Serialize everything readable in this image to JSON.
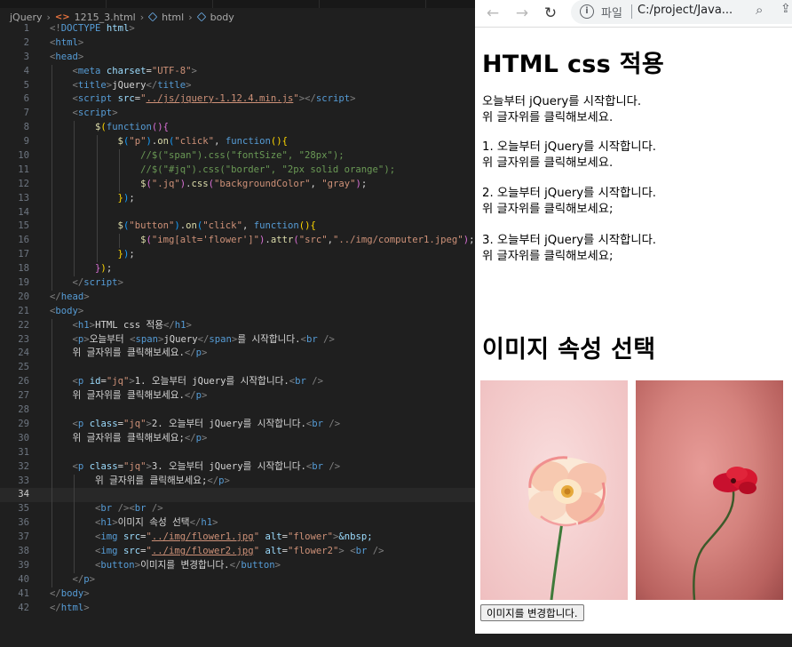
{
  "editor": {
    "breadcrumb": [
      "jQuery",
      "1215_3.html",
      "html",
      "body"
    ],
    "active_line": 34,
    "lines": [
      {
        "n": 1,
        "i": 0,
        "h": "<span class='tg'>&lt;!</span><span class='tn'>DOCTYPE</span> <span class='at'>html</span><span class='tg'>&gt;</span>"
      },
      {
        "n": 2,
        "i": 0,
        "h": "<span class='tg'>&lt;</span><span class='tn'>html</span><span class='tg'>&gt;</span>"
      },
      {
        "n": 3,
        "i": 0,
        "h": "<span class='tg'>&lt;</span><span class='tn'>head</span><span class='tg'>&gt;</span>"
      },
      {
        "n": 4,
        "i": 1,
        "h": "    <span class='tg'>&lt;</span><span class='tn'>meta</span> <span class='at'>charset</span>=<span class='sv'>\"UTF-8\"</span><span class='tg'>&gt;</span>"
      },
      {
        "n": 5,
        "i": 1,
        "h": "    <span class='tg'>&lt;</span><span class='tn'>title</span><span class='tg'>&gt;</span>jQuery<span class='tg'>&lt;/</span><span class='tn'>title</span><span class='tg'>&gt;</span>"
      },
      {
        "n": 6,
        "i": 1,
        "h": "    <span class='tg'>&lt;</span><span class='tn'>script</span> <span class='at'>src</span>=<span class='sv'>\"<span class='uline'>../js/jquery-1.12.4.min.js</span>\"</span><span class='tg'>&gt;&lt;/</span><span class='tn'>script</span><span class='tg'>&gt;</span>"
      },
      {
        "n": 7,
        "i": 1,
        "h": "    <span class='tg'>&lt;</span><span class='tn'>script</span><span class='tg'>&gt;</span>"
      },
      {
        "n": 8,
        "i": 2,
        "h": "        <span class='fn'>$</span><span class='b1'>(</span><span class='kw'>function</span><span class='b2'>()</span><span class='b2'>{</span>"
      },
      {
        "n": 9,
        "i": 3,
        "h": "            <span class='fn'>$</span><span class='b3'>(</span><span class='sv'>\"p\"</span><span class='b3'>)</span>.<span class='fn'>on</span><span class='b3'>(</span><span class='sv'>\"click\"</span>, <span class='kw'>function</span><span class='b1'>()</span><span class='b1'>{</span>"
      },
      {
        "n": 10,
        "i": 4,
        "h": "                <span class='cm'>//$(\"span\").css(\"fontSize\", \"28px\");</span>"
      },
      {
        "n": 11,
        "i": 4,
        "h": "                <span class='cm'>//$(\"#jq\").css(\"border\", \"2px solid orange\");</span>"
      },
      {
        "n": 12,
        "i": 4,
        "h": "                <span class='fn'>$</span><span class='b2'>(</span><span class='sv'>\".jq\"</span><span class='b2'>)</span>.<span class='fn'>css</span><span class='b2'>(</span><span class='sv'>\"backgroundColor\"</span>, <span class='sv'>\"gray\"</span><span class='b2'>)</span>;"
      },
      {
        "n": 13,
        "i": 3,
        "h": "            <span class='b1'>}</span><span class='b3'>)</span>;"
      },
      {
        "n": 14,
        "i": 3,
        "h": ""
      },
      {
        "n": 15,
        "i": 3,
        "h": "            <span class='fn'>$</span><span class='b3'>(</span><span class='sv'>\"button\"</span><span class='b3'>)</span>.<span class='fn'>on</span><span class='b3'>(</span><span class='sv'>\"click\"</span>, <span class='kw'>function</span><span class='b1'>()</span><span class='b1'>{</span>"
      },
      {
        "n": 16,
        "i": 4,
        "h": "                <span class='fn'>$</span><span class='b2'>(</span><span class='sv'>\"img[alt='flower']\"</span><span class='b2'>)</span>.<span class='fn'>attr</span><span class='b2'>(</span><span class='sv'>\"src\"</span>,<span class='sv'>\"../img/computer1.jpeg\"</span><span class='b2'>)</span>;"
      },
      {
        "n": 17,
        "i": 3,
        "h": "            <span class='b1'>}</span><span class='b3'>)</span>;"
      },
      {
        "n": 18,
        "i": 2,
        "h": "        <span class='b2'>}</span><span class='b1'>)</span>;"
      },
      {
        "n": 19,
        "i": 1,
        "h": "    <span class='tg'>&lt;/</span><span class='tn'>script</span><span class='tg'>&gt;</span>"
      },
      {
        "n": 20,
        "i": 0,
        "h": "<span class='tg'>&lt;/</span><span class='tn'>head</span><span class='tg'>&gt;</span>"
      },
      {
        "n": 21,
        "i": 0,
        "h": "<span class='tg'>&lt;</span><span class='tn'>body</span><span class='tg'>&gt;</span>"
      },
      {
        "n": 22,
        "i": 1,
        "h": "    <span class='tg'>&lt;</span><span class='tn'>h1</span><span class='tg'>&gt;</span>HTML css 적용<span class='tg'>&lt;/</span><span class='tn'>h1</span><span class='tg'>&gt;</span>"
      },
      {
        "n": 23,
        "i": 1,
        "h": "    <span class='tg'>&lt;</span><span class='tn'>p</span><span class='tg'>&gt;</span>오늘부터 <span class='tg'>&lt;</span><span class='tn'>span</span><span class='tg'>&gt;</span>jQuery<span class='tg'>&lt;/</span><span class='tn'>span</span><span class='tg'>&gt;</span>를 시작합니다.<span class='tg'>&lt;</span><span class='tn'>br</span> <span class='tg'>/&gt;</span>"
      },
      {
        "n": 24,
        "i": 1,
        "h": "    위 글자위를 클릭해보세요.<span class='tg'>&lt;/</span><span class='tn'>p</span><span class='tg'>&gt;</span>"
      },
      {
        "n": 25,
        "i": 1,
        "h": ""
      },
      {
        "n": 26,
        "i": 1,
        "h": "    <span class='tg'>&lt;</span><span class='tn'>p</span> <span class='at'>id</span>=<span class='sv'>\"jq\"</span><span class='tg'>&gt;</span>1. 오늘부터 jQuery를 시작합니다.<span class='tg'>&lt;</span><span class='tn'>br</span> <span class='tg'>/&gt;</span>"
      },
      {
        "n": 27,
        "i": 1,
        "h": "    위 글자위를 클릭해보세요.<span class='tg'>&lt;/</span><span class='tn'>p</span><span class='tg'>&gt;</span>"
      },
      {
        "n": 28,
        "i": 1,
        "h": ""
      },
      {
        "n": 29,
        "i": 1,
        "h": "    <span class='tg'>&lt;</span><span class='tn'>p</span> <span class='at'>class</span>=<span class='sv'>\"jq\"</span><span class='tg'>&gt;</span>2. 오늘부터 jQuery를 시작합니다.<span class='tg'>&lt;</span><span class='tn'>br</span> <span class='tg'>/&gt;</span>"
      },
      {
        "n": 30,
        "i": 1,
        "h": "    위 글자위를 클릭해보세요;<span class='tg'>&lt;/</span><span class='tn'>p</span><span class='tg'>&gt;</span>"
      },
      {
        "n": 31,
        "i": 1,
        "h": ""
      },
      {
        "n": 32,
        "i": 1,
        "h": "    <span class='tg'>&lt;</span><span class='tn'>p</span> <span class='at'>class</span>=<span class='sv'>\"jq\"</span><span class='tg'>&gt;</span>3. 오늘부터 jQuery를 시작합니다.<span class='tg'>&lt;</span><span class='tn'>br</span> <span class='tg'>/&gt;</span>"
      },
      {
        "n": 33,
        "i": 2,
        "h": "        위 글자위를 클릭해보세요;<span class='tg'>&lt;/</span><span class='tn'>p</span><span class='tg'>&gt;</span>"
      },
      {
        "n": 34,
        "i": 2,
        "h": ""
      },
      {
        "n": 35,
        "i": 2,
        "h": "        <span class='tg'>&lt;</span><span class='tn'>br</span> <span class='tg'>/&gt;&lt;</span><span class='tn'>br</span> <span class='tg'>/&gt;</span>"
      },
      {
        "n": 36,
        "i": 2,
        "h": "        <span class='tg'>&lt;</span><span class='tn'>h1</span><span class='tg'>&gt;</span>이미지 속성 선택<span class='tg'>&lt;/</span><span class='tn'>h1</span><span class='tg'>&gt;</span>"
      },
      {
        "n": 37,
        "i": 2,
        "h": "        <span class='tg'>&lt;</span><span class='tn'>img</span> <span class='at'>src</span>=<span class='sv'>\"<span class='uline'>../img/flower1.jpg</span>\"</span> <span class='at'>alt</span>=<span class='sv'>\"flower\"</span><span class='tg'>&gt;</span><span class='at'>&amp;nbsp;</span>"
      },
      {
        "n": 38,
        "i": 2,
        "h": "        <span class='tg'>&lt;</span><span class='tn'>img</span> <span class='at'>src</span>=<span class='sv'>\"<span class='uline'>../img/flower2.jpg</span>\"</span> <span class='at'>alt</span>=<span class='sv'>\"flower2\"</span><span class='tg'>&gt;</span> <span class='tg'>&lt;</span><span class='tn'>br</span> <span class='tg'>/&gt;</span>"
      },
      {
        "n": 39,
        "i": 2,
        "h": "        <span class='tg'>&lt;</span><span class='tn'>button</span><span class='tg'>&gt;</span>이미지를 변경합니다.<span class='tg'>&lt;/</span><span class='tn'>button</span><span class='tg'>&gt;</span>"
      },
      {
        "n": 40,
        "i": 1,
        "h": "    <span class='tg'>&lt;/</span><span class='tn'>p</span><span class='tg'>&gt;</span>"
      },
      {
        "n": 41,
        "i": 0,
        "h": "<span class='tg'>&lt;/</span><span class='tn'>body</span><span class='tg'>&gt;</span>"
      },
      {
        "n": 42,
        "i": 0,
        "h": "<span class='tg'>&lt;/</span><span class='tn'>html</span><span class='tg'>&gt;</span>"
      }
    ]
  },
  "browser": {
    "address_scheme": "파일",
    "address_url": "C:/project/Java...",
    "back_icon": "arrow-left-icon",
    "forward_icon": "arrow-right-icon",
    "reload_icon": "reload-icon",
    "page": {
      "h1_first": "HTML css 적용",
      "p1_before": "오늘부터 ",
      "p1_span": "jQuery",
      "p1_after": "를 시작합니다.",
      "p1_line2": "위 글자위를 클릭해보세요.",
      "p2_line1": "1. 오늘부터 jQuery를 시작합니다.",
      "p2_line2": "위 글자위를 클릭해보세요.",
      "p3_line1": "2. 오늘부터 jQuery를 시작합니다.",
      "p3_line2": "위 글자위를 클릭해보세요;",
      "p4_line1": "3. 오늘부터 jQuery를 시작합니다.",
      "p4_line2": "위 글자위를 클릭해보세요;",
      "h1_second": "이미지 속성 선택",
      "image1_alt": "flower",
      "image2_alt": "flower2",
      "button_label": "이미지를 변경합니다."
    }
  }
}
